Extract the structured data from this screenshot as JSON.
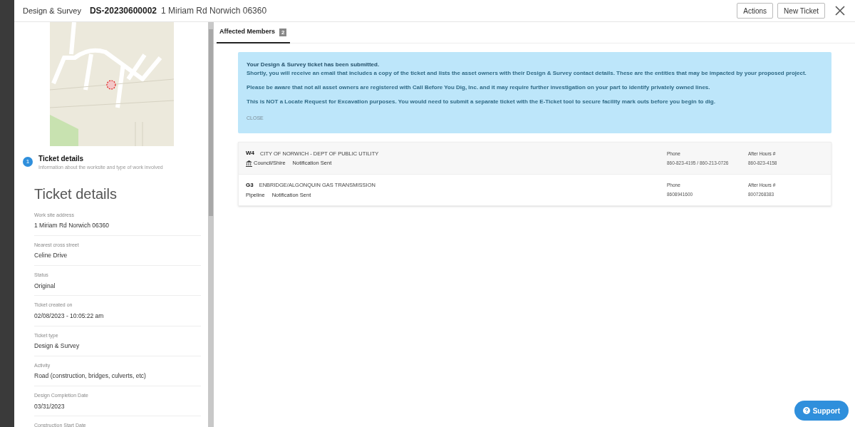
{
  "header": {
    "category": "Design & Survey",
    "ticket_id": "DS-20230600002",
    "address": "1 Miriam Rd Norwich 06360",
    "buttons": [
      "Actions",
      "New Ticket"
    ]
  },
  "step": {
    "number": "1",
    "title": "Ticket details",
    "subtitle": "Information about the worksite and type of work involved"
  },
  "details": {
    "heading": "Ticket details",
    "fields": [
      {
        "label": "Work site address",
        "value": "1 Miriam Rd Norwich  06360"
      },
      {
        "label": "Nearest cross street",
        "value": "Celine Drive"
      },
      {
        "label": "Status",
        "value": "Original"
      },
      {
        "label": "Ticket created on",
        "value": "02/08/2023 - 10:05:22 am"
      },
      {
        "label": "Ticket type",
        "value": "Design & Survey"
      },
      {
        "label": "Activity",
        "value": "Road (construction, bridges, culverts, etc)"
      },
      {
        "label": "Design Completion Date",
        "value": "03/31/2023"
      },
      {
        "label": "Construction Start Date"
      }
    ]
  },
  "tabs": [
    {
      "label": "Affected Members",
      "count": "2",
      "selected": true
    }
  ],
  "alert": {
    "title": "Your Design & Survey ticket has been submitted.",
    "paragraphs": [
      "Shortly, you will receive an email that includes a copy of the ticket and lists the asset owners with their Design & Survey contact details. These are the entities that may be impacted by your proposed project.",
      "Please be aware that not all asset owners are registered with Call Before You Dig, Inc. and it may require further investigation on your part to identify privately owned lines.",
      "This is NOT a Locate Request for Excavation purposes. You would need to submit a separate ticket with the E-Ticket tool to secure facility mark outs before you begin to dig."
    ],
    "close": "CLOSE"
  },
  "members": [
    {
      "code": "W4",
      "name": "CITY OF NORWICH - DEPT OF PUBLIC UTILITY",
      "kind": "council",
      "type": "Council/Shire",
      "status": "Notification Sent",
      "phone_label": "Phone",
      "phone": "860-823-4195 / 860-213-0726",
      "after_hours_label": "After Hours #",
      "after_hours": "860-823-4158"
    },
    {
      "code": "G3",
      "name": "ENBRIDGE/ALGONQUIN GAS TRANSMISSION",
      "kind": "pipeline",
      "type": "Pipeline",
      "status": "Notification Sent",
      "phone_label": "Phone",
      "phone": "8608941600",
      "after_hours_label": "After Hours #",
      "after_hours": "8007268383"
    }
  ],
  "support_button": "Support"
}
